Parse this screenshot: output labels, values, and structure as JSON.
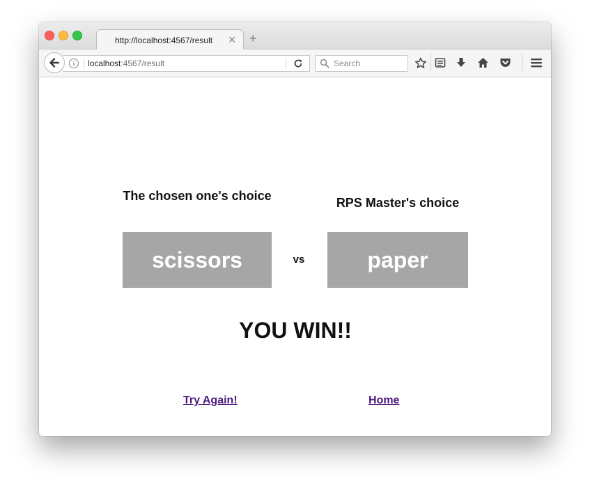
{
  "browser": {
    "tab_title": "http://localhost:4567/result",
    "url_host": "localhost",
    "url_rest": ":4567/result",
    "search_placeholder": "Search"
  },
  "game": {
    "player_heading": "The chosen one's choice",
    "player_choice": "scissors",
    "vs_label": "vs",
    "computer_heading": "RPS Master's choice",
    "computer_choice": "paper",
    "result": "YOU WIN!!",
    "try_again_label": "Try Again!",
    "home_label": "Home"
  },
  "colors": {
    "choice_box_bg": "#a6a6a6",
    "link_visited": "#4b1a7c"
  }
}
